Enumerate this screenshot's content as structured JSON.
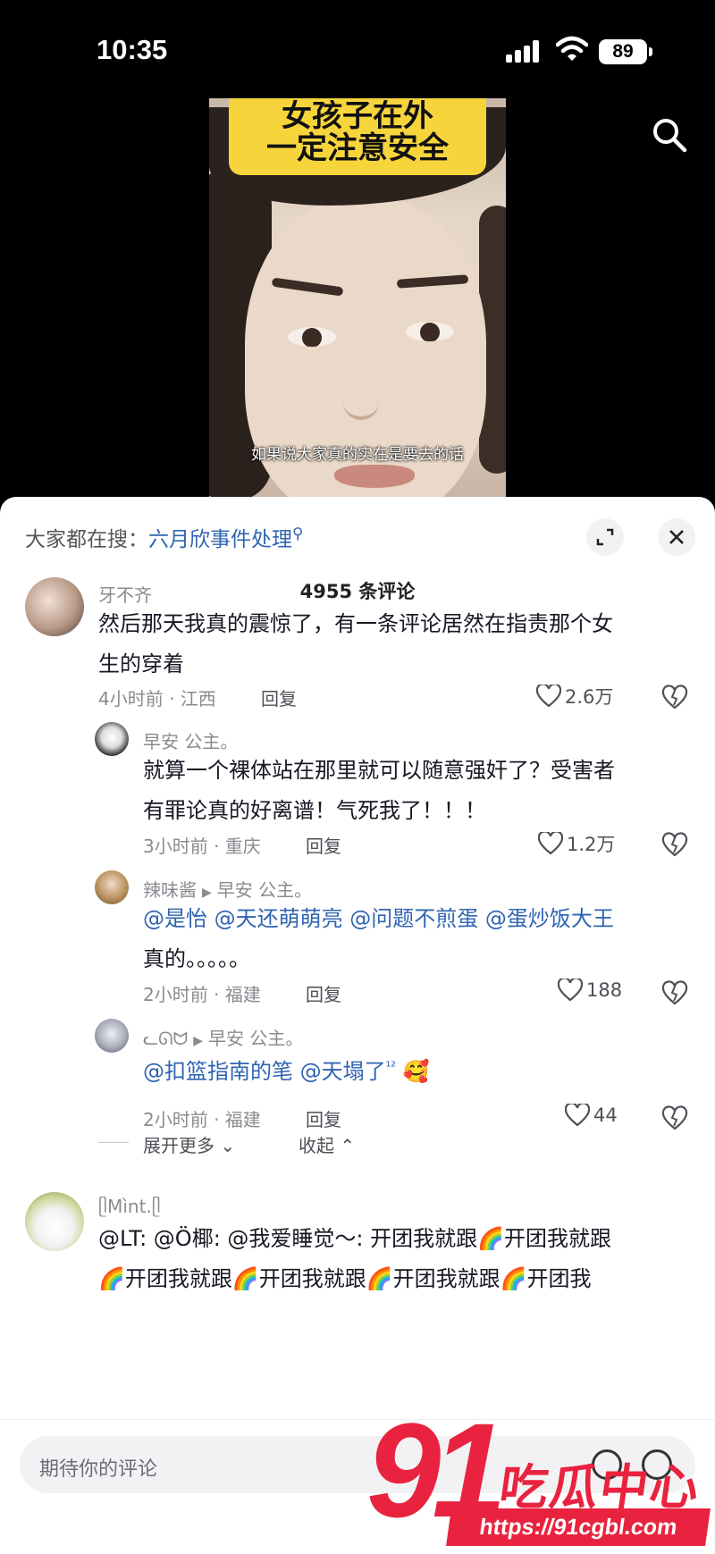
{
  "status_bar": {
    "time": "10:35",
    "battery": "89"
  },
  "video": {
    "banner_line1": "女孩子在外",
    "banner_line2": "一定注意安全",
    "subtitle": "如果说大家真的实在是要去的话"
  },
  "sheet": {
    "hot_search_prefix": "大家都在搜：",
    "hot_search_term": "六月欣事件处理",
    "comment_count": "4955 条评论",
    "expand_more": "展开更多",
    "collapse": "收起"
  },
  "comments": [
    {
      "user": "牙不齐",
      "text_line1": "然后那天我真的震惊了，有一条评论居然在指责那个女",
      "text_line2": "生的穿着",
      "time_loc": "4小时前 · 江西",
      "reply_label": "回复",
      "likes": "2.6万"
    },
    {
      "user": "早安  公主。",
      "text_line1": "就算一个裸体站在那里就可以随意强奸了？受害者",
      "text_line2": "有罪论真的好离谱！气死我了！！！",
      "time_loc": "3小时前 · 重庆",
      "reply_label": "回复",
      "likes": "1.2万"
    },
    {
      "user": "辣味酱",
      "reply_to": "早安  公主。",
      "mentions": [
        "@是怡",
        "@天还萌萌亮",
        "@问题不煎蛋",
        "@蛋炒饭大王"
      ],
      "text_line2": "真的。。。。。",
      "time_loc": "2小时前 · 福建",
      "reply_label": "回复",
      "likes": "188"
    },
    {
      "user": "ᓚᘏᗢ",
      "reply_to": "早安  公主。",
      "mentions": [
        "@扣篮指南的笔",
        "@天塌了"
      ],
      "sup": "¹²",
      "emoji": "🥰",
      "time_loc": "2小时前 · 福建",
      "reply_label": "回复",
      "likes": "44"
    },
    {
      "user": "ᥫMìnt.ᥫ",
      "text_line1": "@LT: @Ö椰: @我爱睡觉～: 开团我就跟🌈开团我就跟",
      "text_line2": "🌈开团我就跟🌈开团我就跟🌈开团我就跟🌈开团我"
    }
  ],
  "input": {
    "placeholder": "期待你的评论"
  },
  "watermark": {
    "number": "91",
    "brand": "吃瓜中心",
    "url": "https://91cgbl.com"
  },
  "colors": {
    "mention": "#2f64b2",
    "banner": "#f6d43c",
    "watermark": "#e9233f"
  }
}
